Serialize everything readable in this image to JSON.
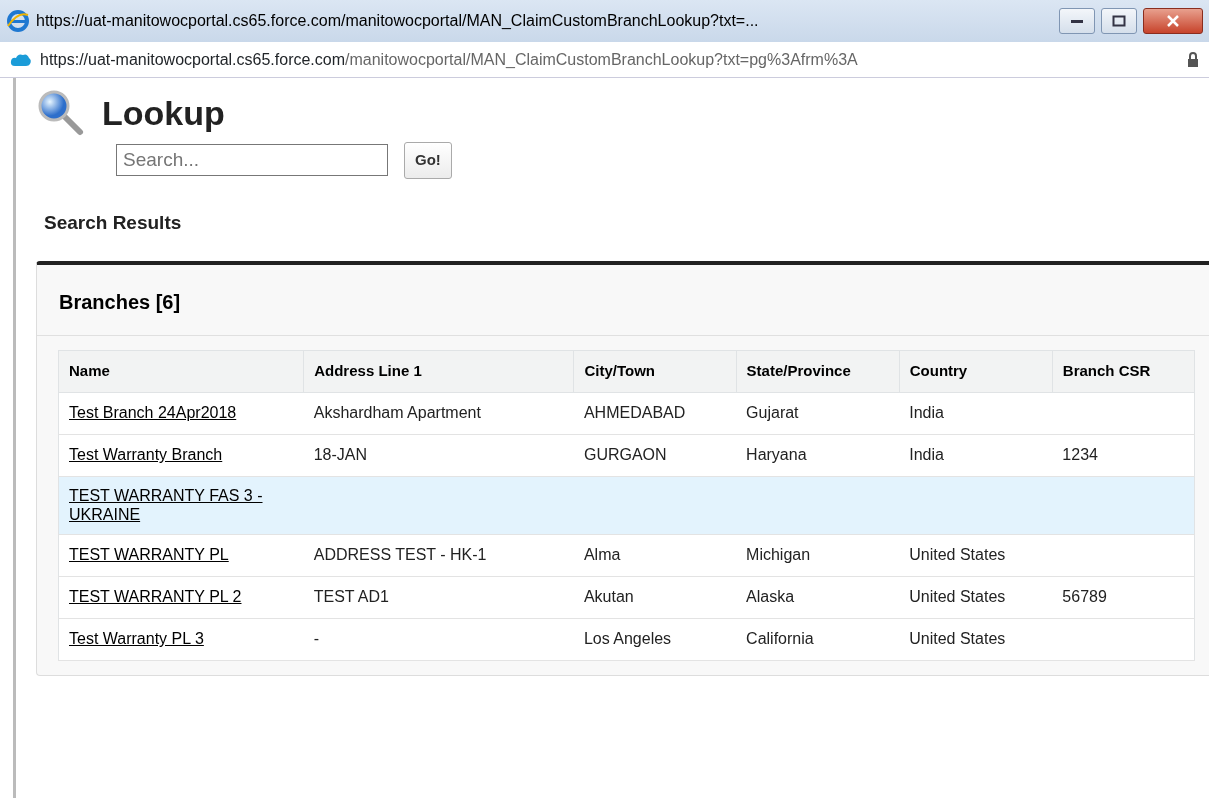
{
  "window": {
    "title": "https://uat-manitowocportal.cs65.force.com/manitowocportal/MAN_ClaimCustomBranchLookup?txt=...",
    "address": {
      "scheme": "https://uat-manitowocportal.cs65.",
      "domain": "force.com",
      "path": "/manitowocportal/MAN_ClaimCustomBranchLookup?txt=pg%3Afrm%3A"
    }
  },
  "page": {
    "title": "Lookup",
    "search": {
      "placeholder": "Search..."
    },
    "go_button": "Go!",
    "results_heading": "Search Results"
  },
  "panel": {
    "title": "Branches [6]",
    "table": {
      "columns": [
        "Name",
        "Address Line 1",
        "City/Town",
        "State/Province",
        "Country",
        "Branch CSR"
      ],
      "rows": [
        {
          "selected": false,
          "cells": [
            "Test Branch 24Apr2018",
            "Akshardham Apartment",
            "AHMEDABAD",
            "Gujarat",
            "India",
            ""
          ]
        },
        {
          "selected": false,
          "cells": [
            "Test Warranty Branch",
            "18-JAN",
            "GURGAON",
            "Haryana",
            "India",
            "1234"
          ]
        },
        {
          "selected": true,
          "cells": [
            "TEST WARRANTY FAS 3 - UKRAINE",
            "",
            "",
            "",
            "",
            ""
          ]
        },
        {
          "selected": false,
          "cells": [
            "TEST WARRANTY PL",
            "ADDRESS TEST - HK-1",
            "Alma",
            "Michigan",
            "United States",
            ""
          ]
        },
        {
          "selected": false,
          "cells": [
            "TEST WARRANTY PL 2",
            "TEST AD1",
            "Akutan",
            "Alaska",
            "United States",
            "56789"
          ]
        },
        {
          "selected": false,
          "cells": [
            "Test Warranty PL 3",
            "-",
            "Los Angeles",
            "California",
            "United States",
            ""
          ]
        }
      ]
    }
  }
}
